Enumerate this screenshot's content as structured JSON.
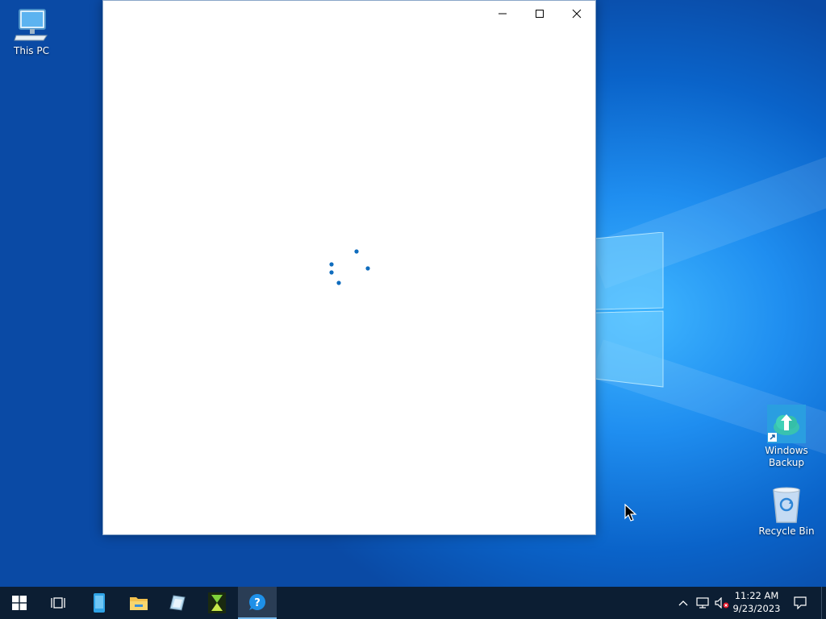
{
  "desktop": {
    "icons": [
      {
        "label": "This PC",
        "icon": "computer-icon"
      },
      {
        "label": "Windows Backup",
        "icon": "cloud-upload-icon"
      },
      {
        "label": "Recycle Bin",
        "icon": "recycle-bin-icon"
      }
    ]
  },
  "window": {
    "title": "",
    "state": "loading",
    "buttons": {
      "minimize": "minimize-icon",
      "maximize": "maximize-icon",
      "close": "close-icon"
    }
  },
  "taskbar": {
    "items": [
      {
        "name": "start",
        "icon": "windows-start-icon"
      },
      {
        "name": "task-view",
        "icon": "task-view-icon"
      },
      {
        "name": "app-blue",
        "icon": "phone-app-icon"
      },
      {
        "name": "file-explorer",
        "icon": "folder-icon"
      },
      {
        "name": "notepad",
        "icon": "notepad-icon"
      },
      {
        "name": "hourglass-app",
        "icon": "hourglass-icon"
      },
      {
        "name": "get-help",
        "icon": "help-icon",
        "active": true
      }
    ],
    "tray": {
      "icons": [
        "chevron-up-icon",
        "network-icon",
        "volume-muted-icon"
      ],
      "time": "11:22 AM",
      "date": "9/23/2023",
      "notification_icon": "action-center-icon"
    }
  },
  "colors": {
    "accent": "#0078d4",
    "taskbar": "#0c1e33",
    "desktop": "#1f8ef0"
  }
}
